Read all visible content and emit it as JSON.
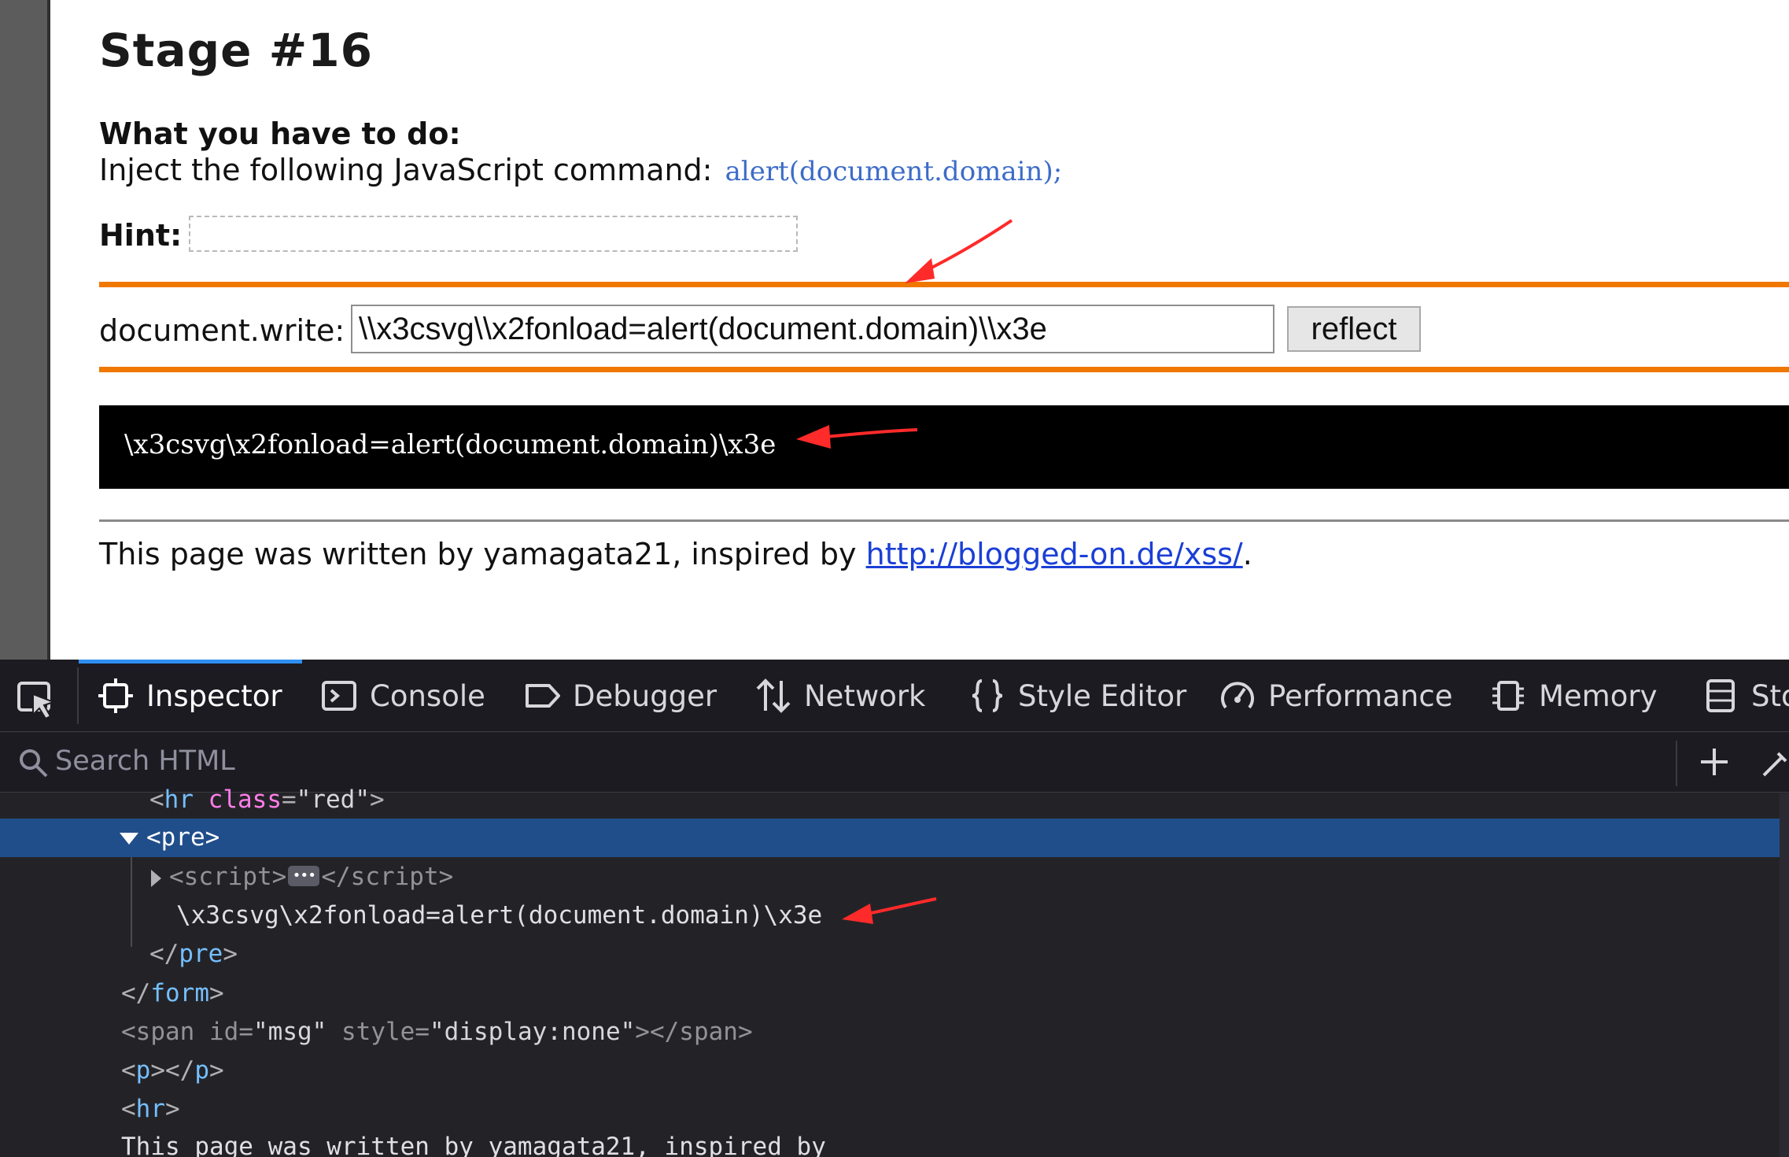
{
  "page": {
    "title": "Stage #16",
    "todo_heading": "What you have to do:",
    "todo_text": "Inject the following JavaScript command:",
    "todo_command": "alert(document.domain);",
    "hint_label": "Hint:",
    "hint_value": "",
    "docwrite_label": "document.write:",
    "docwrite_value": "\\\\x3csvg\\\\x2fonload=alert(document.domain)\\\\x3e",
    "reflect_button": "reflect",
    "output_text": "\\x3csvg\\x2fonload=alert(document.domain)\\x3e",
    "footer_prefix": "This page was written by yamagata21, inspired by",
    "footer_link": "http://blogged-on.de/xss/",
    "footer_suffix": "."
  },
  "devtools": {
    "tabs": [
      {
        "label": "Inspector",
        "icon": "inspector-icon",
        "active": true
      },
      {
        "label": "Console",
        "icon": "console-icon"
      },
      {
        "label": "Debugger",
        "icon": "debugger-icon"
      },
      {
        "label": "Network",
        "icon": "network-icon"
      },
      {
        "label": "Style Editor",
        "icon": "style-editor-icon"
      },
      {
        "label": "Performance",
        "icon": "performance-icon"
      },
      {
        "label": "Memory",
        "icon": "memory-icon"
      },
      {
        "label": "Sto",
        "icon": "storage-icon"
      }
    ],
    "search_placeholder": "Search HTML",
    "markup": {
      "hr_tag": "hr",
      "hr_attr": "class",
      "hr_attr_value": "\"red\"",
      "pre_tag": "pre",
      "script_tag": "script",
      "pre_text": "\\x3csvg\\x2fonload=alert(document.domain)\\x3e",
      "form_tag": "form",
      "span_tag": "span",
      "span_id_attr": "id",
      "span_id_value": "\"msg\"",
      "span_style_attr": "style",
      "span_style_value": "\"display:none\"",
      "p_tag": "p",
      "hr2_tag": "hr",
      "trailing_text": "This page was written by yamagata21, inspired by"
    }
  },
  "colors": {
    "orange_rule": "#f07800",
    "link": "#1a3fd6",
    "command": "#3d6cc8",
    "devtools_bg": "#232327",
    "selected_row": "#204e8a",
    "annotation_arrow": "#ff2a2a"
  }
}
